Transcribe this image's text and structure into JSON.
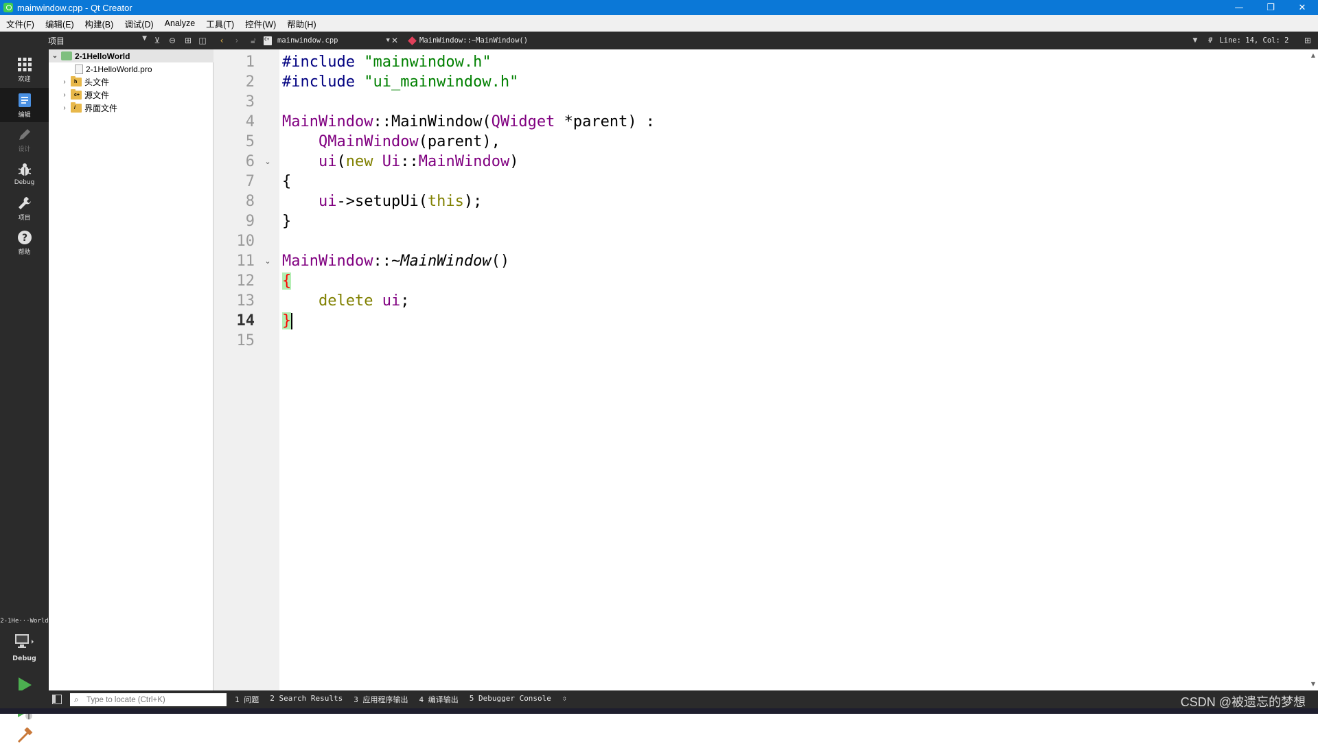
{
  "window": {
    "title": "mainwindow.cpp - Qt Creator",
    "controls": {
      "minimize": "—",
      "restore": "❐",
      "close": "✕"
    }
  },
  "menu": [
    "文件(F)",
    "编辑(E)",
    "构建(B)",
    "调试(D)",
    "Analyze",
    "工具(T)",
    "控件(W)",
    "帮助(H)"
  ],
  "navbar": {
    "project_combo": "项目",
    "file_tab": "mainwindow.cpp",
    "symbol": "MainWindow::~MainWindow()",
    "line_col": "Line: 14, Col: 2",
    "hash": "#"
  },
  "modes": {
    "welcome": "欢迎",
    "edit": "编辑",
    "design": "设计",
    "debug": "Debug",
    "projects": "项目",
    "help": "帮助"
  },
  "kit": {
    "name": "2-1He···World",
    "config": "Debug"
  },
  "tree": {
    "project": "2-1HelloWorld",
    "pro_file": "2-1HelloWorld.pro",
    "headers": "头文件",
    "sources": "源文件",
    "forms": "界面文件",
    "headers_badge": "h",
    "sources_badge": "c+",
    "forms_badge": "/"
  },
  "editor": {
    "line_numbers": [
      "1",
      "2",
      "3",
      "4",
      "5",
      "6",
      "7",
      "8",
      "9",
      "10",
      "11",
      "12",
      "13",
      "14",
      "15"
    ],
    "current_line": "14",
    "code": {
      "l1a": "#include",
      "l1b": "\"mainwindow.h\"",
      "l2a": "#include",
      "l2b": "\"ui_mainwindow.h\"",
      "l4a": "MainWindow",
      "l4b": "::MainWindow(",
      "l4c": "QWidget",
      "l4d": " *parent) :",
      "l5a": "QMainWindow",
      "l5b": "(parent),",
      "l6a": "ui",
      "l6b": "(",
      "l6c": "new",
      "l6d": "Ui",
      "l6e": "::",
      "l6f": "MainWindow",
      "l6g": ")",
      "l7": "{",
      "l8a": "ui",
      "l8b": "->setupUi(",
      "l8c": "this",
      "l8d": ");",
      "l9": "}",
      "l11a": "MainWindow",
      "l11b": "::~",
      "l11c": "MainWindow",
      "l11d": "()",
      "l12": "{",
      "l13a": "delete",
      "l13b": "ui",
      "l13c": ";",
      "l14": "}"
    }
  },
  "status": {
    "locator_placeholder": "Type to locate (Ctrl+K)",
    "panes": [
      "1 问题",
      "2 Search Results",
      "3 应用程序输出",
      "4 编译输出",
      "5 Debugger Console"
    ],
    "watermark": "CSDN @被遗忘的梦想"
  },
  "colors": {
    "title_bar": "#0b78d7",
    "dark_panel": "#2b2b2b",
    "preprocessor": "#000080",
    "string": "#008000",
    "type": "#800080",
    "keyword": "#808000",
    "brace_match": "#b4eeb4"
  }
}
